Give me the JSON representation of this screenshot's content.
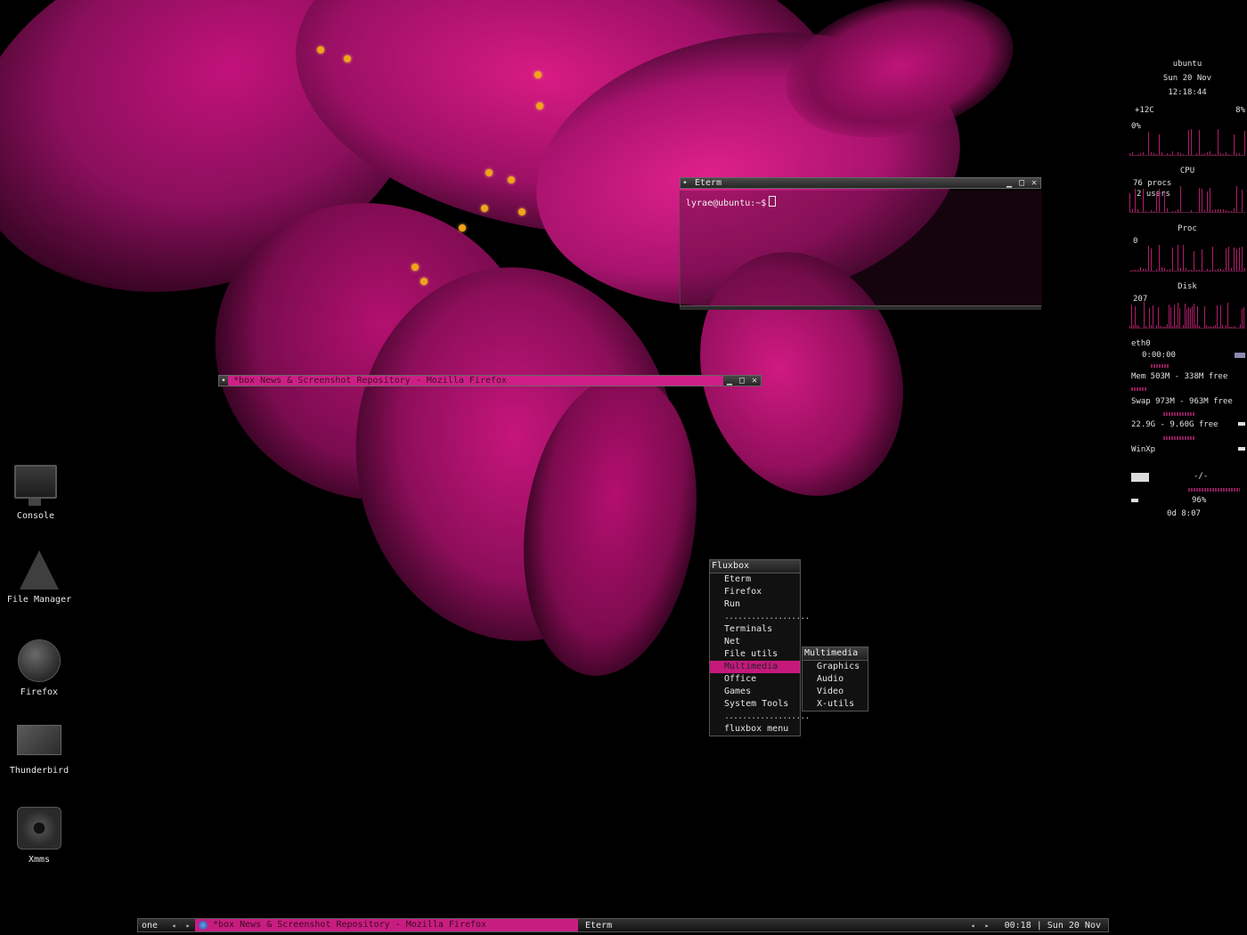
{
  "desktop_icons": [
    {
      "label": "Console",
      "icon": "monitor-icon"
    },
    {
      "label": "File Manager",
      "icon": "file-manager-icon"
    },
    {
      "label": "Firefox",
      "icon": "firefox-icon"
    },
    {
      "label": "Thunderbird",
      "icon": "thunderbird-icon"
    },
    {
      "label": "Xmms",
      "icon": "xmms-icon"
    }
  ],
  "eterm": {
    "title": "Eterm",
    "prompt": "lyrae@ubuntu:~$"
  },
  "firefox_window": {
    "title": "*box News & Screenshot Repository - Mozilla Firefox"
  },
  "window_buttons": {
    "minimize": "▁",
    "maximize": "□",
    "close": "✕"
  },
  "fluxbox_menu": {
    "title": "Fluxbox",
    "items": [
      "Eterm",
      "Firefox",
      "Run",
      "...................",
      "Terminals",
      "Net",
      "File utils",
      "Multimedia",
      "Office",
      "Games",
      "System Tools",
      "...................",
      "fluxbox menu"
    ],
    "active_item": "Multimedia"
  },
  "multimedia_menu": {
    "title": "Multimedia",
    "items": [
      "Graphics",
      "Audio",
      "Video",
      "X-utils"
    ]
  },
  "conky": {
    "hostname": "ubuntu",
    "date": "Sun 20 Nov",
    "time": "12:18:44",
    "temp": "+12C",
    "cpu_pct_right": "8%",
    "cpu_pct_left": "0%",
    "cpu_label": "CPU",
    "procs": "76 procs",
    "users": "2 users",
    "proc_label": "Proc",
    "proc_value": "0",
    "disk_label": "Disk",
    "disk_value": "207",
    "net_iface": "eth0",
    "net_time": "0:00:00",
    "mem": "Mem 503M - 338M free",
    "swap": "Swap 973M - 963M free",
    "disk1": "22.9G - 9.60G free",
    "disk2": "WinXp",
    "mail_status": "-/-",
    "battery": "96%",
    "uptime": "0d  8:07"
  },
  "taskbar": {
    "workspace": "one",
    "active_task": "*box News & Screenshot Repository - Mozilla Firefox",
    "task2": "Eterm",
    "clock": "00:18 | Sun 20 Nov",
    "arrow_left": "◂",
    "arrow_right": "▸"
  },
  "colors": {
    "accent": "#c81d80",
    "background": "#000000",
    "panel": "#262626"
  }
}
